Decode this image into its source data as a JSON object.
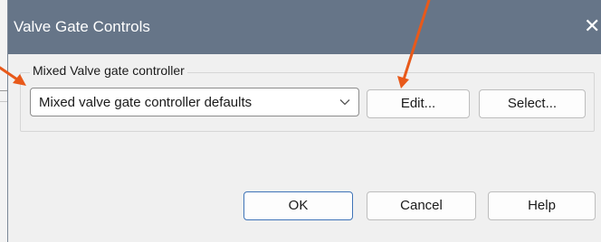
{
  "dialog": {
    "title": "Valve Gate Controls",
    "close_glyph": "✕"
  },
  "group": {
    "label": "Mixed Valve gate controller",
    "combo_value": "Mixed valve gate controller defaults",
    "edit_label": "Edit...",
    "select_label": "Select..."
  },
  "footer": {
    "ok_label": "OK",
    "cancel_label": "Cancel",
    "help_label": "Help"
  },
  "icons": {
    "close": "close-icon",
    "dropdown": "chevron-down-icon",
    "annotation": "arrow-icon"
  },
  "colors": {
    "titlebar": "#667588",
    "annotation_arrow": "#e8591a",
    "default_button_border": "#3f74b8"
  }
}
